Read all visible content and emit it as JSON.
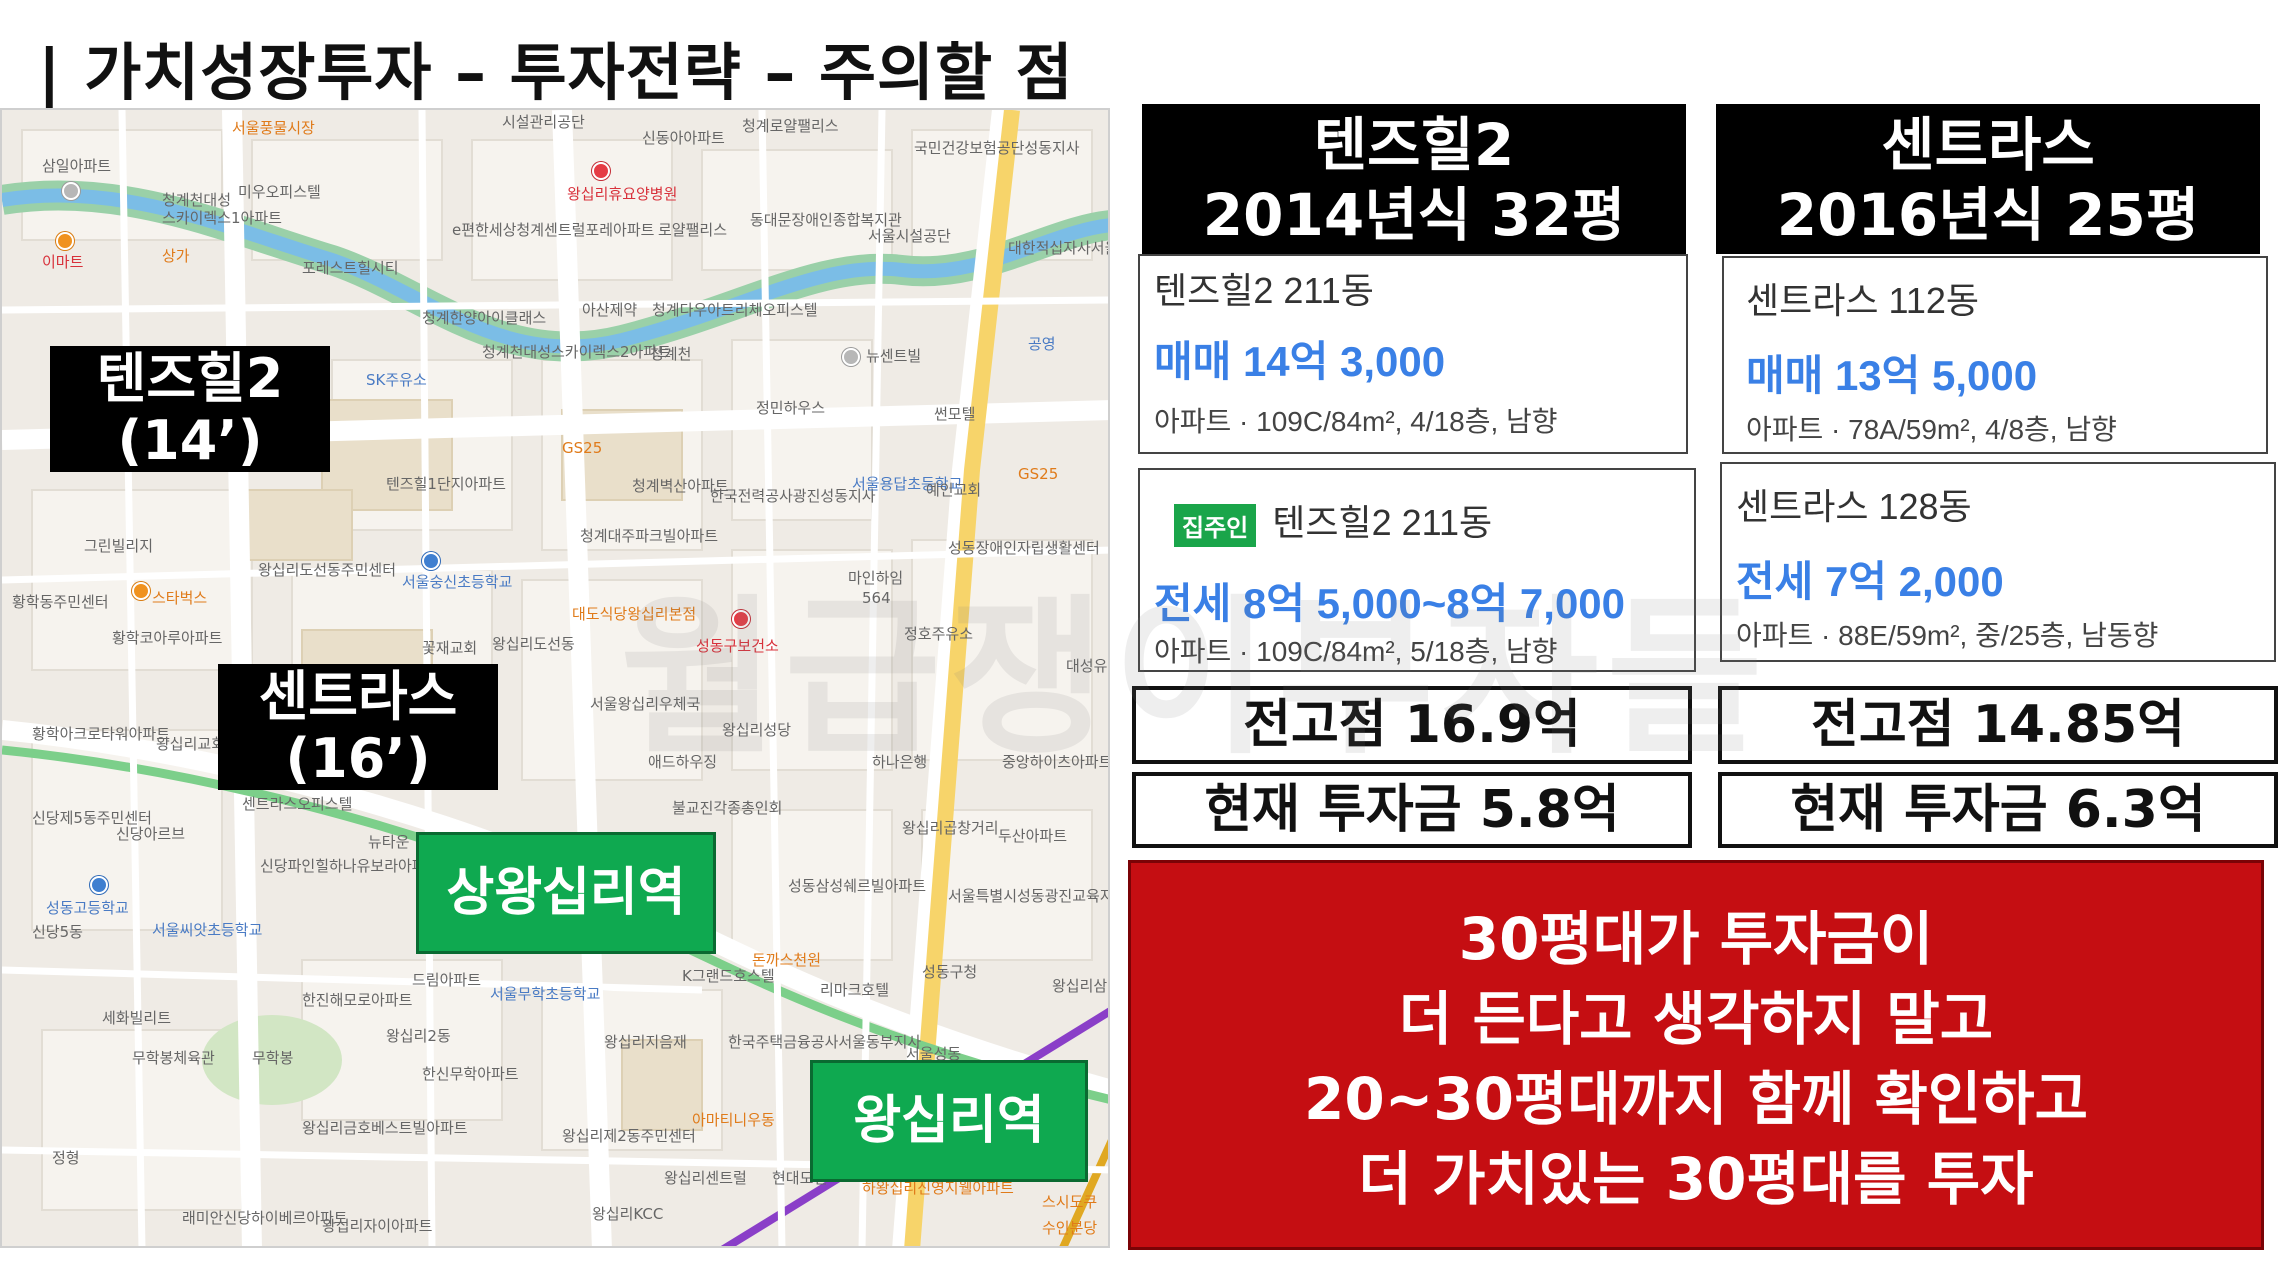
{
  "title": "| 가치성장투자 – 투자전략 – 주의할 점",
  "map": {
    "labels": {
      "tenz": [
        "텐즈힐2",
        "(14’)"
      ],
      "centras": [
        "센트라스",
        "(16’)"
      ],
      "station1": "상왕십리역",
      "station2": "왕십리역"
    },
    "pois": [
      "서울풍물시장",
      "삼일아파트",
      "청계천대성",
      "스카이렉스1아파트",
      "미우오피스텔",
      "상가",
      "이마트",
      "시설관리공단",
      "신동아아파트",
      "청계로얄팰리스",
      "왕십리휴요양병원",
      "e편한세상청계센트럴포레아파트",
      "로얄팰리스",
      "동대문장애인종합복지관",
      "서울시설공단",
      "국민건강보험공단성동지사",
      "대한적십자사서울특별지사",
      "포레스트힐시티",
      "청계한양아이클래스",
      "청계천대성스카이렉스2아파트",
      "아산제약",
      "청계다우아트리체오피스텔",
      "SK주유소",
      "청계천",
      "뉴센트빌",
      "공영",
      "정민하우스",
      "썬모텔",
      "GS25",
      "텐즈힐1단지아파트",
      "청계벽산아파트",
      "한국전력공사광진성동지사",
      "서울용답초등학교",
      "예인교회",
      "그린빌리지",
      "청계대주파크빌아파트",
      "성동장애인자립생활센터",
      "왕십리도선동주민센터",
      "서울숭신초등학교",
      "대도식당왕십리본점",
      "마인하임",
      "564",
      "황학동주민센터",
      "스타벅스",
      "황학코아루아파트",
      "꽃재교회",
      "왕십리도선동",
      "성동구보건소",
      "정호주유소",
      "대성유니드아파트",
      "황학아크로타워아파트",
      "왕십리교회",
      "서울왕십리우체국",
      "왕십리성당",
      "애드하우징",
      "하나은행",
      "중앙하이츠아파트",
      "신당제5동주민센터",
      "신당아르브",
      "센트라스오피스텔",
      "뉴타운",
      "불교진각종총인회",
      "왕십리곱창거리",
      "두산아파트",
      "신당파인힐하나유보라아파트",
      "성동삼성쉐르빌아파트",
      "서울특별시성동광진교육지원청",
      "성동고등학교",
      "서울씨앗초등학교",
      "신당5동",
      "드림아파트",
      "돈까스천원",
      "서울무학초등학교",
      "K그랜드호스텔",
      "리마크호텔",
      "성동구청",
      "왕십리삼성쉐르빌",
      "한진해모로아파트",
      "세화빌리트",
      "왕십리2동",
      "무학봉체육관",
      "무학봉",
      "한신무학아파트",
      "왕십리지음재",
      "한국주택금융공사서울동부지사",
      "서울성동",
      "아마티니우동",
      "왕십리금호베스트빌아파트",
      "왕십리제2동주민센터",
      "왕십리센트럴",
      "현대모텔",
      "정형",
      "래미안신당하이베르아파트",
      "왕십리자이아파트",
      "왕십리KCC",
      "하왕십리신영지웰아파트",
      "스시도쿠",
      "수인분당",
      "왕십리"
    ]
  },
  "watermark": "월급쟁이부자들",
  "compare": [
    {
      "header": [
        "텐즈힐2",
        "2014년식 32평"
      ],
      "sale": {
        "name": "텐즈힐2 211동",
        "price": "매매 14억 3,000",
        "detail": "아파트 · 109C/84m², 4/18층, 남향"
      },
      "lease": {
        "badge": "집주인",
        "name": "텐즈힐2 211동",
        "price": "전세 8억 5,000~8억 7,000",
        "detail": "아파트 · 109C/84m², 5/18층, 남향"
      },
      "peak": "전고점 16.9억",
      "invest": "현재 투자금 5.8억"
    },
    {
      "header": [
        "센트라스",
        "2016년식 25평"
      ],
      "sale": {
        "name": "센트라스 112동",
        "price": "매매 13억 5,000",
        "detail": "아파트 · 78A/59m², 4/8층, 남향"
      },
      "lease": {
        "name": "센트라스 128동",
        "price": "전세 7억 2,000",
        "detail": "아파트 · 88E/59m², 중/25층, 남동향"
      },
      "peak": "전고점 14.85억",
      "invest": "현재 투자금 6.3억"
    }
  ],
  "note": [
    "30평대가 투자금이",
    "더 든다고 생각하지 말고",
    "20~30평대까지 함께 확인하고",
    "더 가치있는 30평대를 투자"
  ],
  "colors": {
    "price_blue": "#3a80e6",
    "station_green": "#0fa950",
    "note_red": "#c50e12",
    "owner_badge_green": "#1aa54a"
  }
}
